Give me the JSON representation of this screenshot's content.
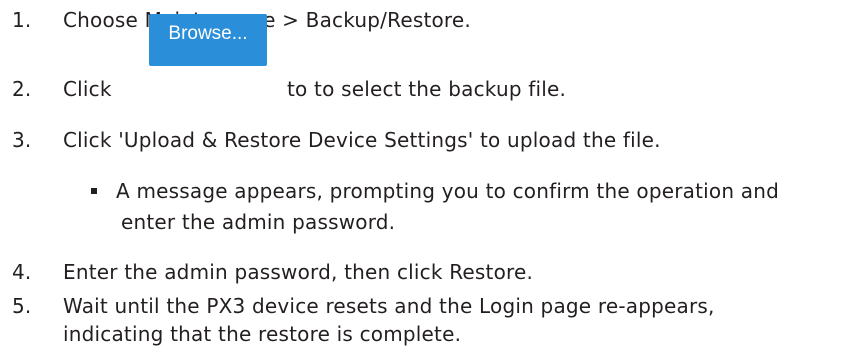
{
  "steps": [
    {
      "number": "1.",
      "text": "Choose Maintenance > Backup/Restore."
    },
    {
      "number": "2.",
      "text_before": "Click",
      "button_label": "Browse...",
      "text_after": "to to select the backup file."
    },
    {
      "number": "3.",
      "text": "Click 'Upload & Restore Device Settings' to upload the file."
    },
    {
      "number": "4.",
      "text": "Enter the admin password, then click Restore."
    },
    {
      "number": "5.",
      "text_line1": "Wait until the PX3 device resets and the Login page re-appears,",
      "text_line2": "indicating that the restore is complete."
    }
  ],
  "note": {
    "line1": "A message appears, prompting you to confirm the operation and",
    "line2": "enter the admin password."
  },
  "colors": {
    "text": "#231f20",
    "button": "#2a8ed9",
    "button_text": "#ffffff"
  }
}
